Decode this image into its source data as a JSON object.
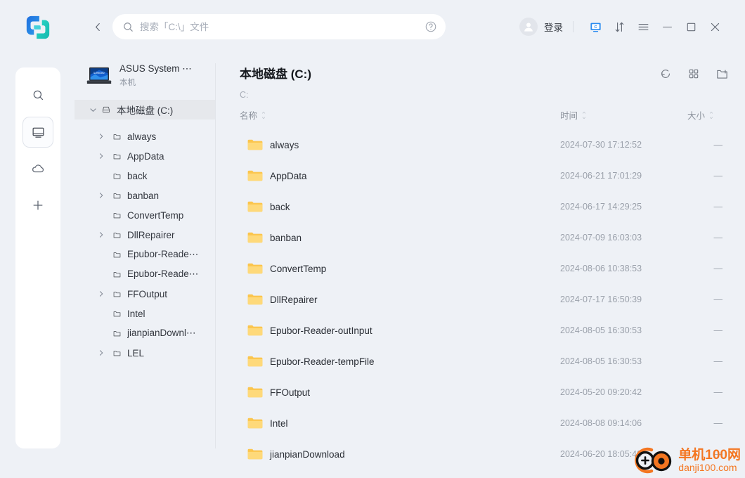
{
  "app": {
    "logo_name": "app-logo",
    "accent": "#2b8cf0",
    "watermark_color": "#f47621"
  },
  "titlebar": {
    "back_icon": "chevron-left-icon",
    "search": {
      "icon": "search-icon",
      "value": "",
      "placeholder": "搜索「C:\\」文件",
      "help_icon": "help-circle-icon"
    },
    "account": {
      "avatar_icon": "user-avatar-icon",
      "label": "登录"
    },
    "buttons": [
      {
        "name": "device-monitor-button",
        "icon": "monitor-icon"
      },
      {
        "name": "transfer-list-button",
        "icon": "transfer-arrows-icon"
      },
      {
        "name": "menu-button",
        "icon": "hamburger-menu-icon"
      },
      {
        "name": "minimize-button",
        "icon": "minimize-icon"
      },
      {
        "name": "maximize-button",
        "icon": "maximize-icon"
      },
      {
        "name": "close-button",
        "icon": "close-icon"
      }
    ]
  },
  "rail": {
    "items": [
      {
        "name": "rail-search",
        "icon": "search-icon",
        "selected": false
      },
      {
        "name": "rail-this-device",
        "icon": "monitor-icon",
        "selected": true
      },
      {
        "name": "rail-cloud",
        "icon": "cloud-icon",
        "selected": false
      },
      {
        "name": "rail-add",
        "icon": "plus-icon",
        "selected": false
      }
    ]
  },
  "sidebar": {
    "device": {
      "thumb_icon": "laptop-thumbnail-icon",
      "name": "ASUS System ⋯",
      "subtitle": "本机"
    },
    "tree": [
      {
        "label": "本地磁盘 (C:)",
        "icon": "drive-icon",
        "caret": "chevron-down-icon",
        "depth": 0,
        "selected": true
      },
      {
        "label": "always",
        "icon": "folder-outline-icon",
        "caret": "chevron-right-icon",
        "depth": 1,
        "selected": false
      },
      {
        "label": "AppData",
        "icon": "folder-outline-icon",
        "caret": "chevron-right-icon",
        "depth": 1,
        "selected": false
      },
      {
        "label": "back",
        "icon": "folder-outline-icon",
        "caret": "",
        "depth": 1,
        "selected": false
      },
      {
        "label": "banban",
        "icon": "folder-outline-icon",
        "caret": "chevron-right-icon",
        "depth": 1,
        "selected": false
      },
      {
        "label": "ConvertTemp",
        "icon": "folder-outline-icon",
        "caret": "",
        "depth": 1,
        "selected": false
      },
      {
        "label": "DllRepairer",
        "icon": "folder-outline-icon",
        "caret": "chevron-right-icon",
        "depth": 1,
        "selected": false
      },
      {
        "label": "Epubor-Reade⋯",
        "icon": "folder-outline-icon",
        "caret": "",
        "depth": 1,
        "selected": false
      },
      {
        "label": "Epubor-Reade⋯",
        "icon": "folder-outline-icon",
        "caret": "",
        "depth": 1,
        "selected": false
      },
      {
        "label": "FFOutput",
        "icon": "folder-outline-icon",
        "caret": "chevron-right-icon",
        "depth": 1,
        "selected": false
      },
      {
        "label": "Intel",
        "icon": "folder-outline-icon",
        "caret": "",
        "depth": 1,
        "selected": false
      },
      {
        "label": "jianpianDownl⋯",
        "icon": "folder-outline-icon",
        "caret": "",
        "depth": 1,
        "selected": false
      },
      {
        "label": "LEL",
        "icon": "folder-outline-icon",
        "caret": "chevron-right-icon",
        "depth": 1,
        "selected": false
      }
    ]
  },
  "main": {
    "title": "本地磁盘 (C:)",
    "path": "C:",
    "tools": [
      {
        "name": "refresh-button",
        "icon": "refresh-icon"
      },
      {
        "name": "view-grid-button",
        "icon": "grid-view-icon"
      },
      {
        "name": "new-folder-button",
        "icon": "new-folder-icon"
      }
    ],
    "columns": {
      "name": "名称",
      "time": "时间",
      "size": "大小"
    },
    "rows": [
      {
        "icon": "folder-icon",
        "name": "always",
        "time": "2024-07-30 17:12:52",
        "size": "—"
      },
      {
        "icon": "folder-icon",
        "name": "AppData",
        "time": "2024-06-21 17:01:29",
        "size": "—"
      },
      {
        "icon": "folder-icon",
        "name": "back",
        "time": "2024-06-17 14:29:25",
        "size": "—"
      },
      {
        "icon": "folder-icon",
        "name": "banban",
        "time": "2024-07-09 16:03:03",
        "size": "—"
      },
      {
        "icon": "folder-icon",
        "name": "ConvertTemp",
        "time": "2024-08-06 10:38:53",
        "size": "—"
      },
      {
        "icon": "folder-icon",
        "name": "DllRepairer",
        "time": "2024-07-17 16:50:39",
        "size": "—"
      },
      {
        "icon": "folder-icon",
        "name": "Epubor-Reader-outInput",
        "time": "2024-08-05 16:30:53",
        "size": "—"
      },
      {
        "icon": "folder-icon",
        "name": "Epubor-Reader-tempFile",
        "time": "2024-08-05 16:30:53",
        "size": "—"
      },
      {
        "icon": "folder-icon",
        "name": "FFOutput",
        "time": "2024-05-20 09:20:42",
        "size": "—"
      },
      {
        "icon": "folder-icon",
        "name": "Intel",
        "time": "2024-08-08 09:14:06",
        "size": "—"
      },
      {
        "icon": "folder-icon",
        "name": "jianpianDownload",
        "time": "2024-06-20 18:05:48",
        "size": "—"
      }
    ]
  },
  "watermark": {
    "cn": "单机100网",
    "en": "danji100.com"
  }
}
